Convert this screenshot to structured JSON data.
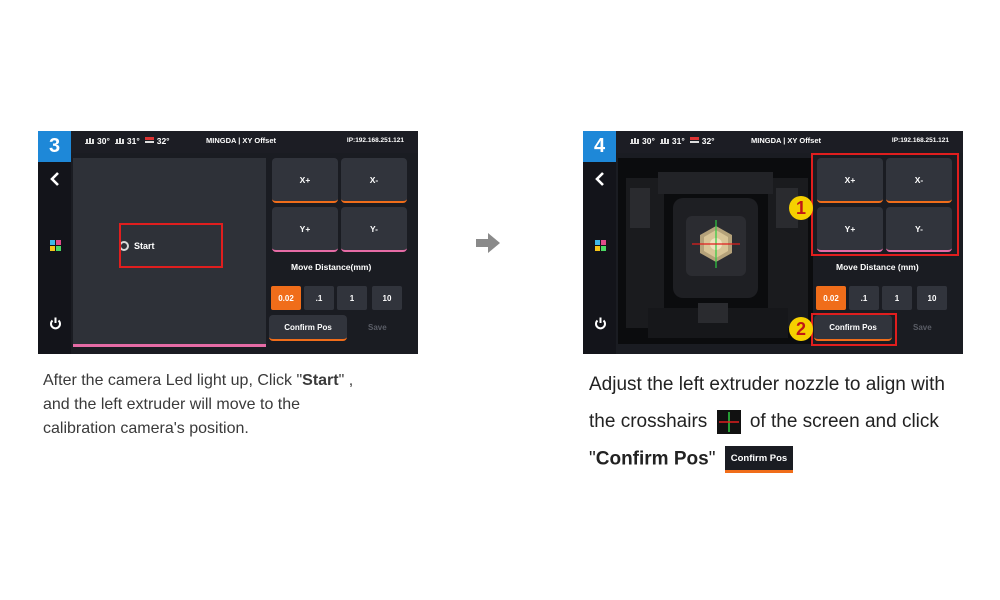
{
  "step3": {
    "badge": "3",
    "temps": [
      "30°",
      "31°",
      "32°"
    ],
    "title": "MINGDA | XY Offset",
    "ip": "IP:192.168.251.121",
    "start_label": "Start",
    "buttons": {
      "xplus": "X+",
      "xminus": "X-",
      "yplus": "Y+",
      "yminus": "Y-"
    },
    "move_distance_label": "Move Distance(mm)",
    "distances": [
      "0.02",
      ".1",
      "1",
      "10"
    ],
    "confirm_label": "Confirm Pos",
    "save_label": "Save"
  },
  "step4": {
    "badge": "4",
    "temps": [
      "30°",
      "31°",
      "32°"
    ],
    "title": "MINGDA | XY Offset",
    "ip": "IP:192.168.251.121",
    "buttons": {
      "xplus": "X+",
      "xminus": "X-",
      "yplus": "Y+",
      "yminus": "Y-"
    },
    "move_distance_label": "Move Distance (mm)",
    "distances": [
      "0.02",
      ".1",
      "1",
      "10"
    ],
    "confirm_label": "Confirm Pos",
    "save_label": "Save",
    "callouts": [
      "1",
      "2"
    ]
  },
  "caption1": {
    "line1_pre": "After the camera Led light up, Click \"",
    "line1_bold": "Start",
    "line1_post": "\" ,",
    "line2": "and the left extruder will move to the",
    "line3": "calibration camera's position."
  },
  "caption2": {
    "line1": "Adjust the left extruder nozzle to align with",
    "line2_pre": "the crosshairs",
    "line2_post": "of the screen and click",
    "line3_q1": "\"",
    "line3_bold": "Confirm Pos",
    "line3_q2": "\"",
    "inline_button": "Confirm Pos"
  },
  "colors": {
    "accent_orange": "#f06d1a",
    "accent_pink": "#e56ba5",
    "badge_blue": "#1e88d8",
    "highlight_red": "#e01e1e",
    "callout_yellow": "#f5d000"
  },
  "icons": [
    "bed-temp-icon",
    "nozzle-temp-icon",
    "chamber-temp-icon",
    "back-chevron-icon",
    "apps-grid-icon",
    "power-icon",
    "arrow-right-icon",
    "crosshair-icon"
  ]
}
